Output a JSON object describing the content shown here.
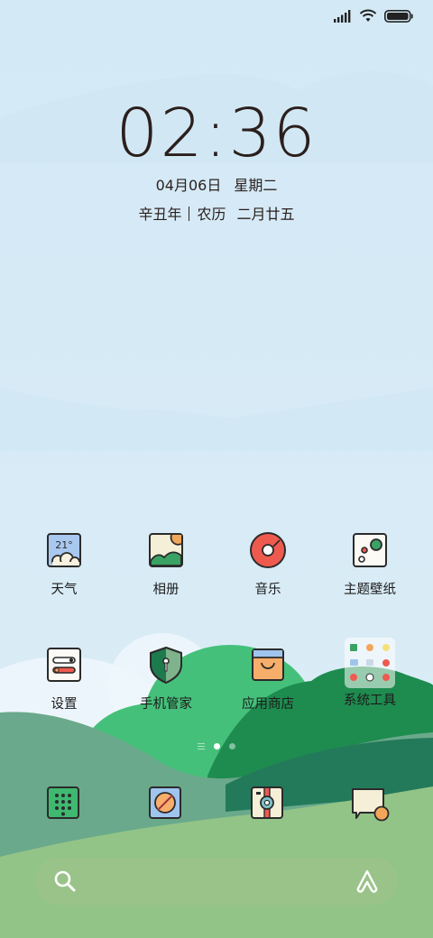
{
  "status_bar": {
    "signal_icon": "cellular-signal-icon",
    "wifi_icon": "wifi-icon",
    "battery_icon": "battery-icon",
    "battery_level": 1.0
  },
  "lockscreen_clock": {
    "time": "02:36",
    "date": "04月06日",
    "weekday": "星期二",
    "lunar_year": "辛丑年",
    "lunar_label": "农历",
    "lunar_day": "二月廿五"
  },
  "apps": [
    {
      "label": "天气",
      "icon": "weather-icon",
      "temp": "21°"
    },
    {
      "label": "相册",
      "icon": "gallery-icon"
    },
    {
      "label": "音乐",
      "icon": "music-icon"
    },
    {
      "label": "主题壁纸",
      "icon": "themes-icon"
    },
    {
      "label": "设置",
      "icon": "settings-icon"
    },
    {
      "label": "手机管家",
      "icon": "security-icon"
    },
    {
      "label": "应用商店",
      "icon": "app-store-icon"
    },
    {
      "label": "系统工具",
      "icon": "system-tools-folder-icon"
    }
  ],
  "page_indicator": {
    "pages": 2,
    "active": 1
  },
  "dock": [
    {
      "icon": "phone-dialer-icon"
    },
    {
      "icon": "browser-compass-icon"
    },
    {
      "icon": "camera-icon"
    },
    {
      "icon": "messages-icon"
    }
  ],
  "search_bar": {
    "search_icon": "search-icon",
    "assistant_icon": "assistant-icon"
  },
  "colors": {
    "sky": "#d6ebf6",
    "hill_light": "#43c17b",
    "hill_dark": "#1f8a4e",
    "valley": "#6fa88a",
    "grass": "#93c487",
    "icon_outline": "#2b2b2b"
  }
}
